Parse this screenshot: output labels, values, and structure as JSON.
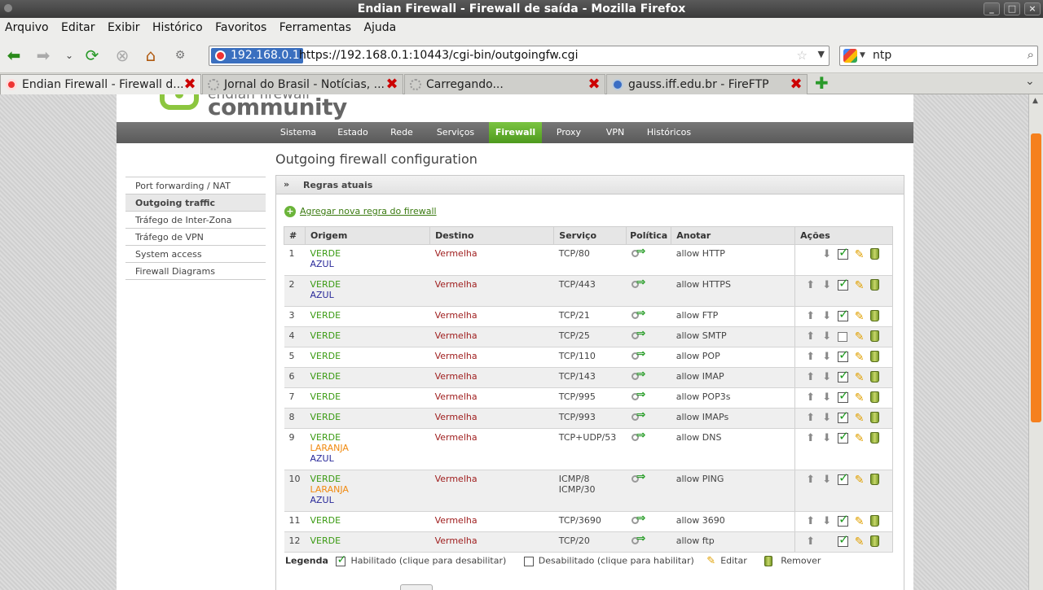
{
  "window": {
    "title": "Endian Firewall - Firewall de saída - Mozilla Firefox",
    "controls": [
      "_",
      "□",
      "×"
    ]
  },
  "menu": [
    "Arquivo",
    "Editar",
    "Exibir",
    "Histórico",
    "Favoritos",
    "Ferramentas",
    "Ajuda"
  ],
  "navbar": {
    "url_host": "192.168.0.1",
    "url": "https://192.168.0.1:10443/cgi-bin/outgoingfw.cgi",
    "search_value": "ntp"
  },
  "tabs": [
    {
      "label": "Endian Firewall - Firewall d...",
      "active": true,
      "icon": "endian-icon"
    },
    {
      "label": "Jornal do Brasil - Notícias, ...",
      "active": false,
      "icon": "loading-icon"
    },
    {
      "label": "Carregando...",
      "active": false,
      "icon": "loading-icon"
    },
    {
      "label": "gauss.iff.edu.br - FireFTP",
      "active": false,
      "icon": "fireftp-icon"
    }
  ],
  "logo": {
    "line1": "endian firewall",
    "line2": "community"
  },
  "topnav": [
    "Sistema",
    "Estado",
    "Rede",
    "Serviços",
    "Firewall",
    "Proxy",
    "VPN",
    "Históricos"
  ],
  "topnav_active": "Firewall",
  "page_title": "Outgoing firewall configuration",
  "sidenav": [
    "Port forwarding / NAT",
    "Outgoing traffic",
    "Tráfego de Inter-Zona",
    "Tráfego de VPN",
    "System access",
    "Firewall Diagrams"
  ],
  "sidenav_active": "Outgoing traffic",
  "section": {
    "arrow": "»",
    "title": "Regras atuais"
  },
  "add_link": "Agregar nova regra do firewall",
  "table": {
    "headers": [
      "#",
      "Origem",
      "Destino",
      "Serviço",
      "Política",
      "Anotar",
      "Ações"
    ],
    "rows": [
      {
        "n": "1",
        "origem": [
          "VERDE",
          "AZUL"
        ],
        "destino": "Vermelha",
        "servico": [
          "TCP/80"
        ],
        "anotar": "allow HTTP",
        "up": false,
        "down": true,
        "enabled": true
      },
      {
        "n": "2",
        "origem": [
          "VERDE",
          "AZUL"
        ],
        "destino": "Vermelha",
        "servico": [
          "TCP/443"
        ],
        "anotar": "allow HTTPS",
        "up": true,
        "down": true,
        "enabled": true
      },
      {
        "n": "3",
        "origem": [
          "VERDE"
        ],
        "destino": "Vermelha",
        "servico": [
          "TCP/21"
        ],
        "anotar": "allow FTP",
        "up": true,
        "down": true,
        "enabled": true
      },
      {
        "n": "4",
        "origem": [
          "VERDE"
        ],
        "destino": "Vermelha",
        "servico": [
          "TCP/25"
        ],
        "anotar": "allow SMTP",
        "up": true,
        "down": true,
        "enabled": false
      },
      {
        "n": "5",
        "origem": [
          "VERDE"
        ],
        "destino": "Vermelha",
        "servico": [
          "TCP/110"
        ],
        "anotar": "allow POP",
        "up": true,
        "down": true,
        "enabled": true
      },
      {
        "n": "6",
        "origem": [
          "VERDE"
        ],
        "destino": "Vermelha",
        "servico": [
          "TCP/143"
        ],
        "anotar": "allow IMAP",
        "up": true,
        "down": true,
        "enabled": true
      },
      {
        "n": "7",
        "origem": [
          "VERDE"
        ],
        "destino": "Vermelha",
        "servico": [
          "TCP/995"
        ],
        "anotar": "allow POP3s",
        "up": true,
        "down": true,
        "enabled": true
      },
      {
        "n": "8",
        "origem": [
          "VERDE"
        ],
        "destino": "Vermelha",
        "servico": [
          "TCP/993"
        ],
        "anotar": "allow IMAPs",
        "up": true,
        "down": true,
        "enabled": true
      },
      {
        "n": "9",
        "origem": [
          "VERDE",
          "LARANJA",
          "AZUL"
        ],
        "destino": "Vermelha",
        "servico": [
          "TCP+UDP/53"
        ],
        "anotar": "allow DNS",
        "up": true,
        "down": true,
        "enabled": true
      },
      {
        "n": "10",
        "origem": [
          "VERDE",
          "LARANJA",
          "AZUL"
        ],
        "destino": "Vermelha",
        "servico": [
          "ICMP/8",
          "ICMP/30"
        ],
        "anotar": "allow PING",
        "up": true,
        "down": true,
        "enabled": true
      },
      {
        "n": "11",
        "origem": [
          "VERDE"
        ],
        "destino": "Vermelha",
        "servico": [
          "TCP/3690"
        ],
        "anotar": "allow 3690",
        "up": true,
        "down": true,
        "enabled": true
      },
      {
        "n": "12",
        "origem": [
          "VERDE"
        ],
        "destino": "Vermelha",
        "servico": [
          "TCP/20"
        ],
        "anotar": "allow ftp",
        "up": true,
        "down": false,
        "enabled": true
      }
    ]
  },
  "legend": {
    "title": "Legenda",
    "enabled": "Habilitado (clique para desabilitar)",
    "disabled": "Desabilitado (clique para habilitar)",
    "edit": "Editar",
    "remove": "Remover"
  },
  "colors": {
    "verde": "#3a9a12",
    "azul": "#2a2a9a",
    "laranja": "#f08a10",
    "vermelha": "#a02020",
    "nav_active": "#5aa82a",
    "scroll_thumb": "#f5801e"
  }
}
